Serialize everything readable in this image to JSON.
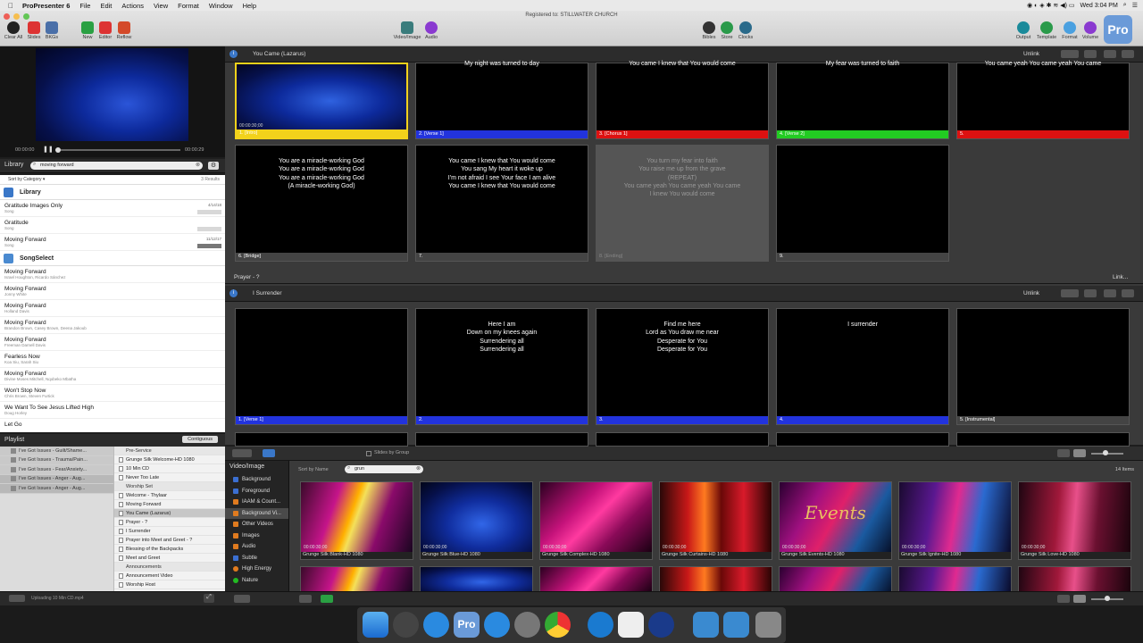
{
  "menubar": {
    "app_name": "ProPresenter 6",
    "menus": [
      "File",
      "Edit",
      "Actions",
      "View",
      "Format",
      "Window",
      "Help"
    ],
    "clock": "Wed 3:04 PM"
  },
  "toolbar": {
    "registered": "Registered to: STILLWATER CHURCH",
    "left": [
      "Clear All",
      "Slides",
      "BKGs"
    ],
    "edit": [
      "New",
      "Editor",
      "Reflow"
    ],
    "media": [
      "Video/Image",
      "Audio"
    ],
    "tools": [
      "Bibles",
      "Store",
      "Clocks"
    ],
    "right": [
      "Output",
      "Template",
      "Format",
      "Volume"
    ],
    "pro_badge": "Pro"
  },
  "preview": {
    "time_current": "00:00:00",
    "time_total": "00:00:29"
  },
  "library": {
    "title": "Library",
    "search_value": "moving forward",
    "sort_label": "Sort by Category",
    "results": "3 Results",
    "sections": [
      {
        "name": "Library",
        "items": [
          {
            "title": "Gratitude Images Only",
            "sub": "Song",
            "date": "4/14/18"
          },
          {
            "title": "Gratitude",
            "sub": "Song",
            "date": ""
          },
          {
            "title": "Moving Forward",
            "sub": "Song",
            "date": "11/12/17"
          }
        ]
      },
      {
        "name": "SongSelect",
        "items": [
          {
            "title": "Moving Forward",
            "sub": "Israel Houghton, Ricardo Sánchez",
            "date": ""
          },
          {
            "title": "Moving Forward",
            "sub": "Jonny White",
            "date": ""
          },
          {
            "title": "Moving Forward",
            "sub": "Holland Davis",
            "date": ""
          },
          {
            "title": "Moving Forward",
            "sub": "Brandon Brown, Casey Brown, Deena Jakoub",
            "date": ""
          },
          {
            "title": "Moving Forward",
            "sub": "Freeman Darnell Davis",
            "date": ""
          },
          {
            "title": "Fearless Now",
            "sub": "Koa Siu, Sarah Siu",
            "date": ""
          },
          {
            "title": "Moving Forward",
            "sub": "Divine Moses Mitchell, Nqobeko Mbatha",
            "date": ""
          },
          {
            "title": "Won't Stop Now",
            "sub": "Chris Brown, Steven Furtick",
            "date": ""
          },
          {
            "title": "We Want To See Jesus Lifted High",
            "sub": "Doug Horley",
            "date": ""
          },
          {
            "title": "Let Go",
            "sub": "",
            "date": ""
          }
        ]
      }
    ]
  },
  "playlist": {
    "title": "Playlist",
    "mode": "Contiguous",
    "lists": [
      "I've Got Issues - Guilt/Shame...",
      "I've Got Issues - Trauma/Pain...",
      "I've Got Issues - Fear/Anxiety...",
      "I've Got Issues - Anger - Aug...",
      "I've Got Issues - Anger - Aug..."
    ],
    "items": [
      {
        "label": "Pre-Service",
        "type": "header"
      },
      {
        "label": "Grunge Silk Welcome-HD 1080",
        "type": "item"
      },
      {
        "label": "10 Min CD",
        "type": "item"
      },
      {
        "label": "Never Too Late",
        "type": "item"
      },
      {
        "label": "Worship Set",
        "type": "header"
      },
      {
        "label": "Welcome - Thylaar",
        "type": "item"
      },
      {
        "label": "Moving Forward",
        "type": "item"
      },
      {
        "label": "You Came (Lazarus)",
        "type": "selected"
      },
      {
        "label": "Prayer - ?",
        "type": "item"
      },
      {
        "label": "I Surrender",
        "type": "item"
      },
      {
        "label": "Prayer into Meet and Greet - ?",
        "type": "item"
      },
      {
        "label": "Blessing of the Backpacks",
        "type": "item"
      },
      {
        "label": "Meet and Greet",
        "type": "item"
      },
      {
        "label": "Announcements",
        "type": "header"
      },
      {
        "label": "Announcement Video",
        "type": "item"
      },
      {
        "label": "Worship Host",
        "type": "item"
      }
    ],
    "status": "Uploading 10 Min CD.mp4"
  },
  "presentations": [
    {
      "title": "You Came (Lazarus)",
      "unlink": "Unlink",
      "slides": [
        {
          "text": "",
          "label": "1. [Intro]",
          "color": "#f2d21b",
          "dur": "00:00:30;00",
          "bg": "blue"
        },
        {
          "text": "My night was turned to day",
          "label": "2. [Verse 1]",
          "color": "#2233dd"
        },
        {
          "text": "You came I knew that You would come",
          "label": "3. [Chorus 1]",
          "color": "#dd1111"
        },
        {
          "text": "My fear was turned to faith",
          "label": "4. [Verse 2]",
          "color": "#22cc22"
        },
        {
          "text": "You came yeah You came yeah You came",
          "label": "5.",
          "color": "#dd1111"
        },
        {
          "text": "You are a miracle-working God\nYou are a miracle-working God\nYou are a miracle-working God\n(A miracle-working God)",
          "label": "6. [Bridge]",
          "color": "#444444"
        },
        {
          "text": "You came I knew that You would come\nYou sang My heart it woke up\nI'm not afraid I see Your face I am alive\nYou came I knew that You would come",
          "label": "7.",
          "color": "#444444"
        },
        {
          "text": "You turn my fear into faith\nYou raise me up from the grave\n(REPEAT)\nYou came yeah You came yeah You came\nI knew You would come",
          "label": "8. [Ending]",
          "color": "#555555",
          "dim": true
        },
        {
          "text": "",
          "label": "9.",
          "color": "#444444"
        }
      ]
    },
    {
      "title": "Prayer - ?",
      "link": "Link..."
    },
    {
      "title": "I Surrender",
      "unlink": "Unlink",
      "slides": [
        {
          "text": "",
          "label": "1. [Verse 1]",
          "color": "#2233dd"
        },
        {
          "text": "Here I am\nDown on my knees again\nSurrendering all\nSurrendering all",
          "label": "2.",
          "color": "#2233dd"
        },
        {
          "text": "Find me here\nLord as You draw me near\nDesperate for You\nDesperate for You",
          "label": "3.",
          "color": "#2233dd"
        },
        {
          "text": "I surrender",
          "label": "4.",
          "color": "#2233dd"
        },
        {
          "text": "",
          "label": "5. [Instrumental]",
          "color": "#444444"
        }
      ]
    }
  ],
  "slides_footer": {
    "group_toggle": "Slides by Group"
  },
  "media": {
    "title": "Video/Image",
    "sort": "Sort by Name",
    "search_value": "grun",
    "count": "14 Items",
    "categories": [
      {
        "name": "Background",
        "color": "#3b6fd1"
      },
      {
        "name": "Foreground",
        "color": "#3b6fd1"
      },
      {
        "name": "IAAM & Count...",
        "color": "#e07b1f"
      },
      {
        "name": "Background Vi...",
        "color": "#e07b1f",
        "selected": true
      },
      {
        "name": "Other Videos",
        "color": "#e07b1f"
      },
      {
        "name": "Images",
        "color": "#e07b1f"
      },
      {
        "name": "Audio",
        "color": "#e07b1f"
      },
      {
        "name": "Subtle",
        "color": "#3b6fd1"
      },
      {
        "name": "High Energy",
        "color": "#e07b1f"
      },
      {
        "name": "Nature",
        "color": "#22bb22"
      }
    ],
    "thumbs": [
      {
        "name": "Grunge Silk Blank-HD 1080",
        "dur": "00:00:30;00",
        "grad": "linear-gradient(110deg,#3a0a2a 0%,#c5148a 30%,#ffb000 45%,#f4e05a 50%,#8a0a6a 70%,#1a0520 100%)"
      },
      {
        "name": "Grunge Silk Blue-HD 1080",
        "dur": "00:00:30;00",
        "grad": "radial-gradient(ellipse at 55% 60%,#3166e8 0%,#102d9e 40%,#06104a 75%,#020518 100%)"
      },
      {
        "name": "Grunge Silk Complex-HD 1080",
        "dur": "00:00:30;00",
        "grad": "linear-gradient(135deg,#2a0020 0%,#c4127a 35%,#ff3aa0 50%,#8a0a58 70%,#1a0012 100%)"
      },
      {
        "name": "Grunge Silk Curtains-HD 1080",
        "dur": "00:00:30;00",
        "grad": "linear-gradient(90deg,#2a0808 0%,#c81818 25%,#ff7a20 40%,#6a0808 55%,#d81a2a 75%,#2a0404 100%)"
      },
      {
        "name": "Grunge Silk Events-HD 1080",
        "dur": "00:00:30;00",
        "grad": "linear-gradient(120deg,#2a0030 0%,#a01080 30%,#e0206a 50%,#1a5aa0 75%,#06102a 100%)"
      },
      {
        "name": "Grunge Silk Ignite-HD 1080",
        "dur": "00:00:30;00",
        "grad": "linear-gradient(100deg,#1a0a30 0%,#5a1890 30%,#e02a90 50%,#2a6ad0 70%,#0a0a2a 100%)"
      },
      {
        "name": "Grunge Silk Love-HD 1080",
        "dur": "00:00:30;00",
        "grad": "linear-gradient(95deg,#200612 0%,#a0183a 35%,#e8508a 50%,#6a1030 70%,#1a040c 100%)"
      }
    ],
    "events_overlay": "Events"
  }
}
